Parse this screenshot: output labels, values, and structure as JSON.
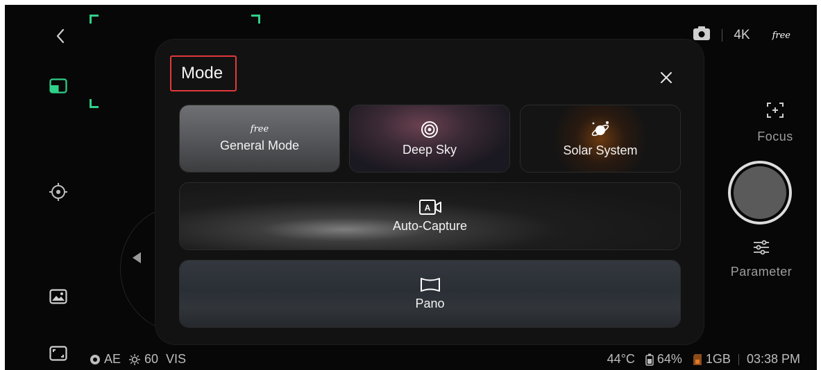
{
  "modal": {
    "title": "Mode",
    "modes": [
      {
        "label": "General Mode",
        "badge": "free",
        "icon": "free-badge-icon"
      },
      {
        "label": "Deep Sky",
        "icon": "target-rings-icon"
      },
      {
        "label": "Solar System",
        "icon": "planet-icon"
      },
      {
        "label": "Auto-Capture",
        "icon": "auto-camera-icon"
      },
      {
        "label": "Pano",
        "icon": "panorama-icon"
      }
    ],
    "close_icon": "close-icon"
  },
  "top_bar": {
    "resolution": "4K",
    "free_badge": "free",
    "camera_icon": "camera-icon"
  },
  "right_controls": {
    "focus_label": "Focus",
    "parameter_label": "Parameter"
  },
  "left_controls": {
    "icons": [
      "back-icon",
      "layout-icon",
      "locate-icon",
      "gallery-icon",
      "fullscreen-icon"
    ]
  },
  "status_bar": {
    "ae": "AE",
    "brightness": "60",
    "vis": "VIS",
    "temperature": "44°C",
    "battery": "64%",
    "storage": "1GB",
    "time": "03:38 PM"
  },
  "colors": {
    "highlight_border": "#e2393b",
    "viewfinder_marks": "#2fd089"
  }
}
